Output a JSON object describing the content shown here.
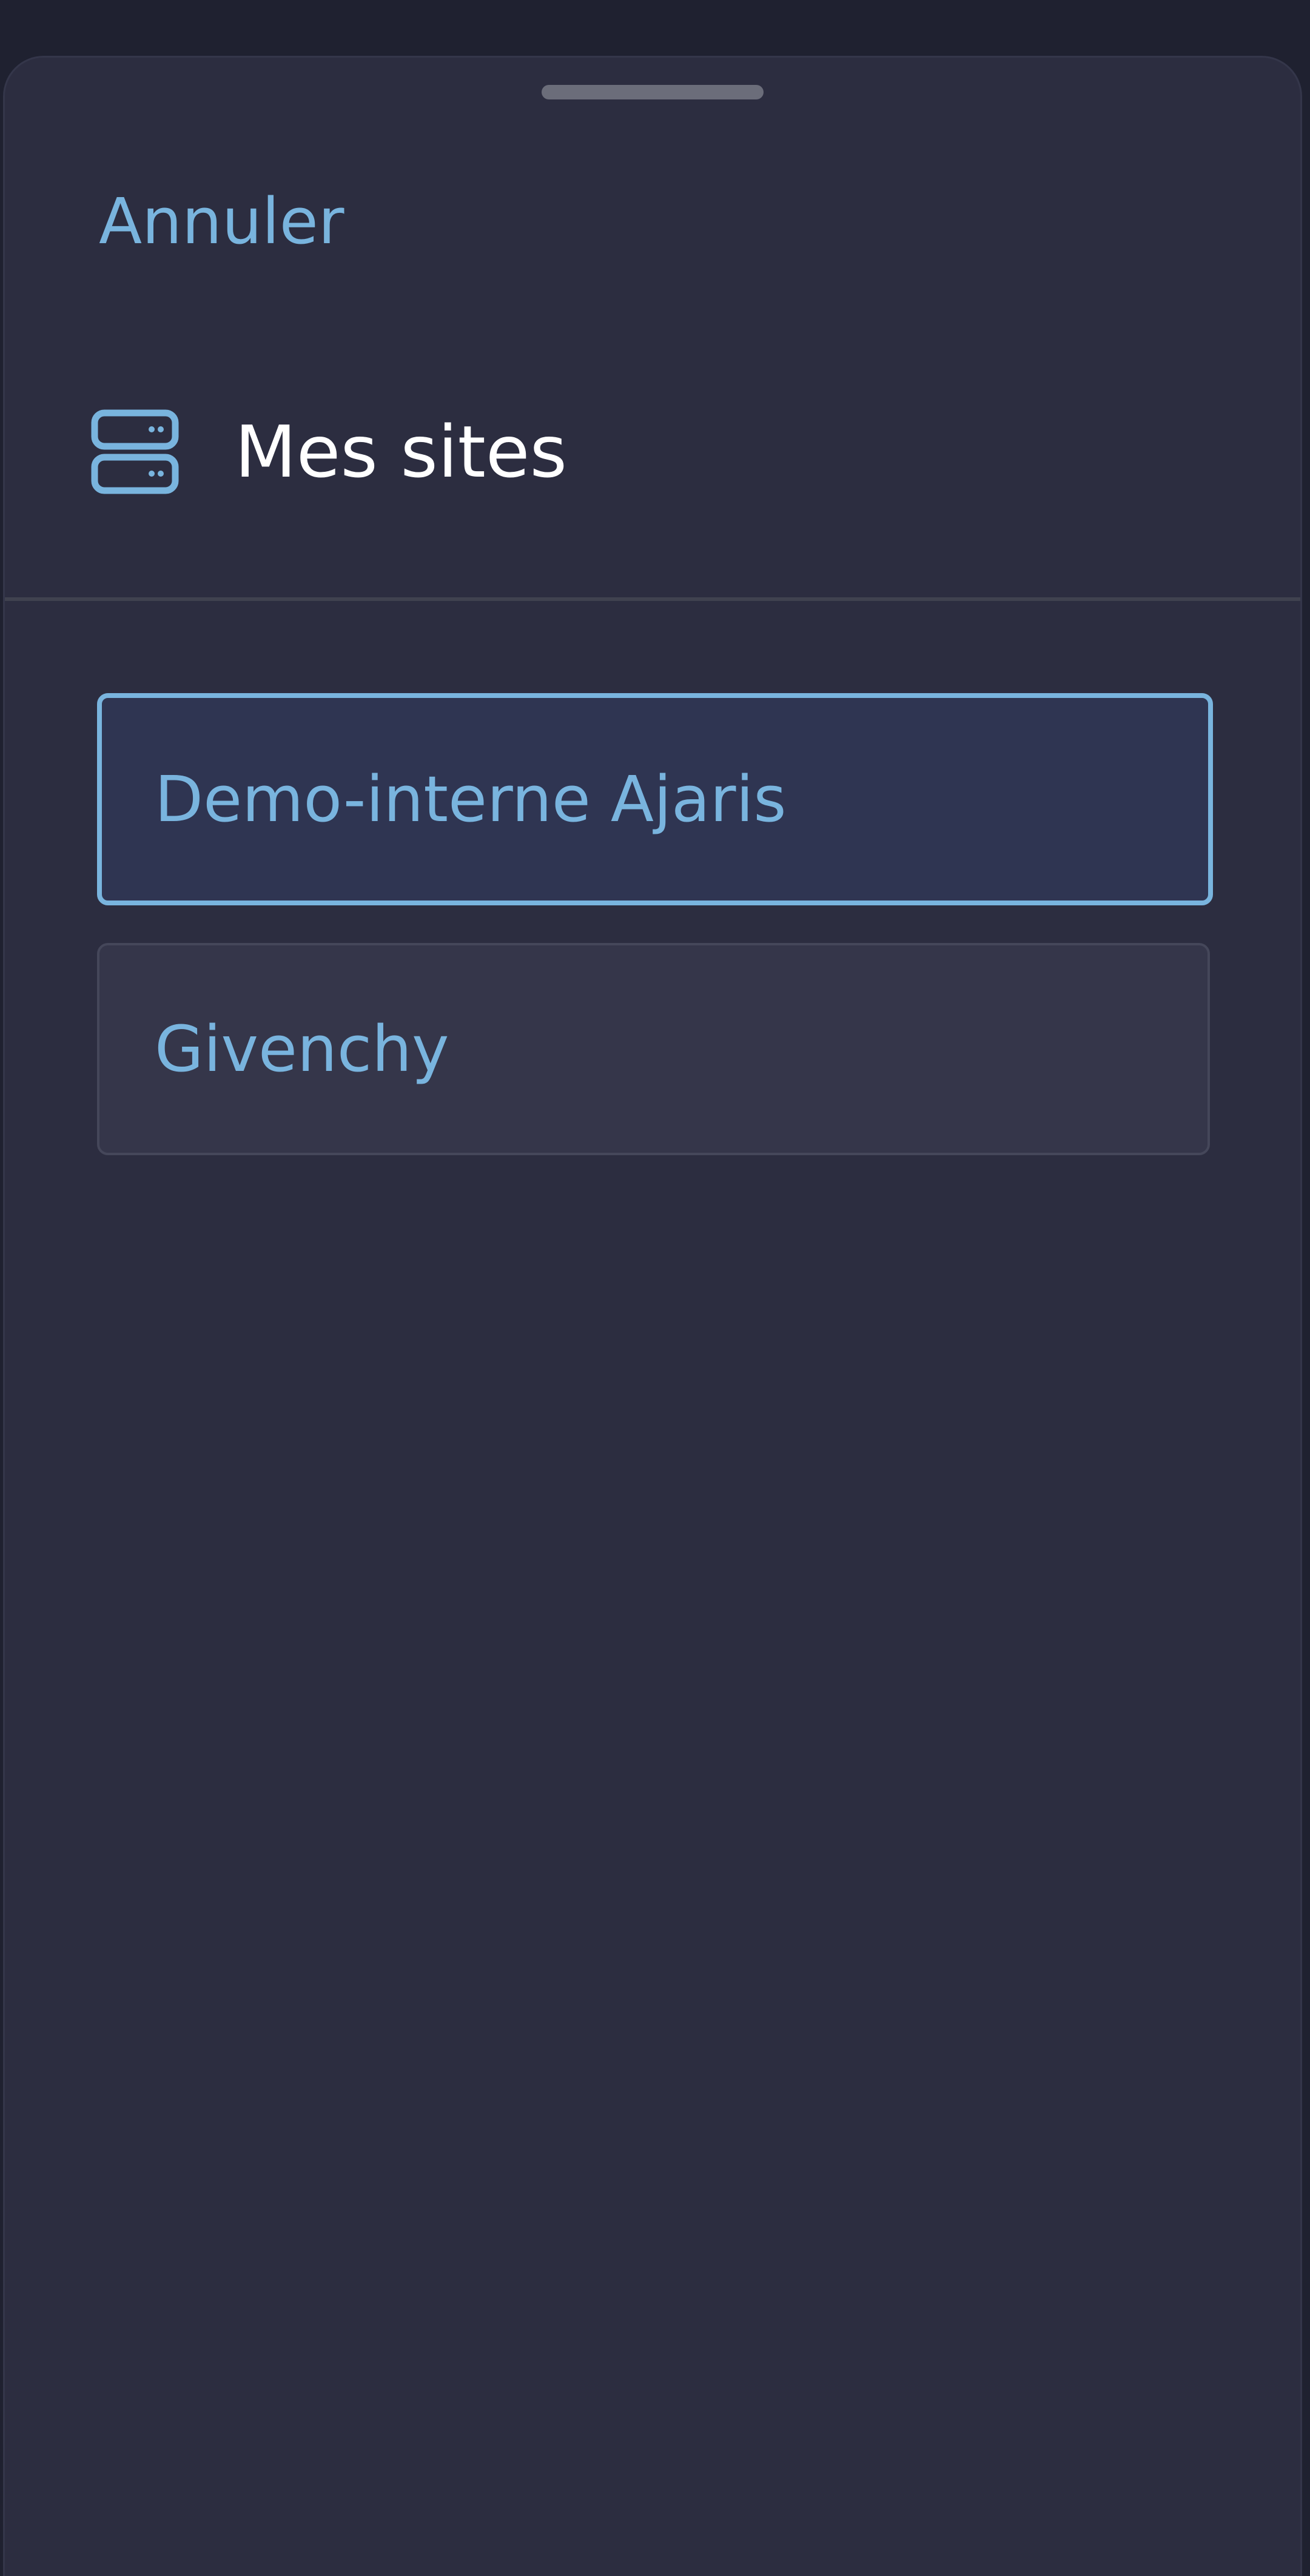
{
  "sheet": {
    "cancel_label": "Annuler",
    "title": "Mes sites",
    "title_icon": "server-icon"
  },
  "sites": [
    {
      "label": "Demo-interne Ajaris",
      "selected": true
    },
    {
      "label": "Givenchy",
      "selected": false
    }
  ],
  "colors": {
    "background": "#1f2130",
    "sheet": "#2c2d40",
    "accent": "#79b4de",
    "selected_item_bg": "#2f3552",
    "item_bg": "#35364a"
  }
}
